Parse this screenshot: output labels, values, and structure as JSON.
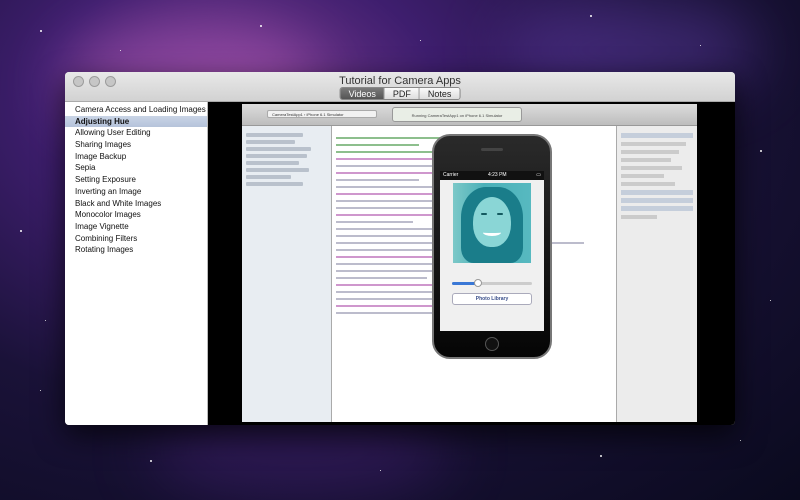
{
  "window": {
    "title": "Tutorial for Camera Apps",
    "tabs": [
      {
        "label": "Videos",
        "active": true
      },
      {
        "label": "PDF",
        "active": false
      },
      {
        "label": "Notes",
        "active": false
      }
    ]
  },
  "sidebar": {
    "items": [
      {
        "label": "Camera Access and Loading Images",
        "selected": false
      },
      {
        "label": "Adjusting Hue",
        "selected": true
      },
      {
        "label": "Allowing User Editing",
        "selected": false
      },
      {
        "label": "Sharing Images",
        "selected": false
      },
      {
        "label": "Image Backup",
        "selected": false
      },
      {
        "label": "Sepia",
        "selected": false
      },
      {
        "label": "Setting Exposure",
        "selected": false
      },
      {
        "label": "Inverting an Image",
        "selected": false
      },
      {
        "label": "Black and White Images",
        "selected": false
      },
      {
        "label": "Monocolor Images",
        "selected": false
      },
      {
        "label": "Image Vignette",
        "selected": false
      },
      {
        "label": "Combining Filters",
        "selected": false
      },
      {
        "label": "Rotating Images",
        "selected": false
      }
    ]
  },
  "video": {
    "xcode_scheme": "CameraTestApp1 › iPhone 6.1 Simulator",
    "xcode_status": "Running CameraTestApp1 on iPhone 6.1 Simulator",
    "phone": {
      "carrier": "Carrier",
      "time": "4:23 PM",
      "slider_value": 0.32,
      "button_label": "Photo Library"
    }
  },
  "colors": {
    "selection": "#c9d4e6",
    "slider": "#3a78d6"
  }
}
